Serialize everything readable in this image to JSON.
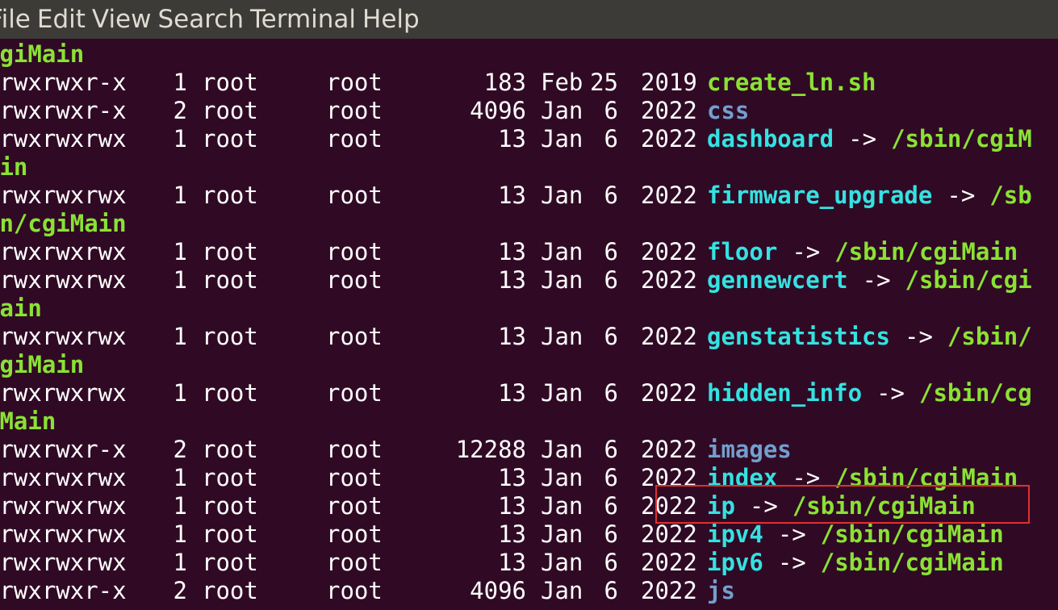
{
  "menubar": {
    "items": [
      "File",
      "Edit",
      "View",
      "Search",
      "Terminal",
      "Help"
    ]
  },
  "colors": {
    "background": "#300a24",
    "menubar_bg": "#3c3b37",
    "text": "#ffffff",
    "executable": "#8ae234",
    "directory": "#729fcf",
    "symlink": "#34e2e2",
    "highlight": "#e03030"
  },
  "listing": [
    {
      "kind": "wrap",
      "text": "cgiMain"
    },
    {
      "kind": "entry",
      "perm": "-rwxrwxr-x",
      "links": "1",
      "owner": "root",
      "group": "root",
      "size": "183",
      "month": "Feb",
      "day": "25",
      "year": "2019",
      "name": "create_ln.sh",
      "type": "exec",
      "arrow": "",
      "target": ""
    },
    {
      "kind": "entry",
      "perm": "drwxrwxr-x",
      "links": "2",
      "owner": "root",
      "group": "root",
      "size": "4096",
      "month": "Jan",
      "day": "6",
      "year": "2022",
      "name": "css",
      "type": "dir",
      "arrow": "",
      "target": ""
    },
    {
      "kind": "entry",
      "perm": "lrwxrwxrwx",
      "links": "1",
      "owner": "root",
      "group": "root",
      "size": "13",
      "month": "Jan",
      "day": "6",
      "year": "2022",
      "name": "dashboard",
      "type": "link",
      "arrow": "->",
      "target": "/sbin/cgiM"
    },
    {
      "kind": "wrap",
      "text": "ain"
    },
    {
      "kind": "entry",
      "perm": "lrwxrwxrwx",
      "links": "1",
      "owner": "root",
      "group": "root",
      "size": "13",
      "month": "Jan",
      "day": "6",
      "year": "2022",
      "name": "firmware_upgrade",
      "type": "link",
      "arrow": "->",
      "target": "/sb"
    },
    {
      "kind": "wrap",
      "text": "in/cgiMain"
    },
    {
      "kind": "entry",
      "perm": "lrwxrwxrwx",
      "links": "1",
      "owner": "root",
      "group": "root",
      "size": "13",
      "month": "Jan",
      "day": "6",
      "year": "2022",
      "name": "floor",
      "type": "link",
      "arrow": "->",
      "target": "/sbin/cgiMain"
    },
    {
      "kind": "entry",
      "perm": "lrwxrwxrwx",
      "links": "1",
      "owner": "root",
      "group": "root",
      "size": "13",
      "month": "Jan",
      "day": "6",
      "year": "2022",
      "name": "gennewcert",
      "type": "link",
      "arrow": "->",
      "target": "/sbin/cgi"
    },
    {
      "kind": "wrap",
      "text": "Main"
    },
    {
      "kind": "entry",
      "perm": "lrwxrwxrwx",
      "links": "1",
      "owner": "root",
      "group": "root",
      "size": "13",
      "month": "Jan",
      "day": "6",
      "year": "2022",
      "name": "genstatistics",
      "type": "link",
      "arrow": "->",
      "target": "/sbin/"
    },
    {
      "kind": "wrap",
      "text": "cgiMain"
    },
    {
      "kind": "entry",
      "perm": "lrwxrwxrwx",
      "links": "1",
      "owner": "root",
      "group": "root",
      "size": "13",
      "month": "Jan",
      "day": "6",
      "year": "2022",
      "name": "hidden_info",
      "type": "link",
      "arrow": "->",
      "target": "/sbin/cg"
    },
    {
      "kind": "wrap",
      "text": "iMain"
    },
    {
      "kind": "entry",
      "perm": "drwxrwxr-x",
      "links": "2",
      "owner": "root",
      "group": "root",
      "size": "12288",
      "month": "Jan",
      "day": "6",
      "year": "2022",
      "name": "images",
      "type": "dir",
      "arrow": "",
      "target": ""
    },
    {
      "kind": "entry",
      "perm": "lrwxrwxrwx",
      "links": "1",
      "owner": "root",
      "group": "root",
      "size": "13",
      "month": "Jan",
      "day": "6",
      "year": "2022",
      "name": "index",
      "type": "link",
      "arrow": "->",
      "target": "/sbin/cgiMain"
    },
    {
      "kind": "entry",
      "perm": "lrwxrwxrwx",
      "links": "1",
      "owner": "root",
      "group": "root",
      "size": "13",
      "month": "Jan",
      "day": "6",
      "year": "2022",
      "name": "ip",
      "type": "link",
      "arrow": "->",
      "target": "/sbin/cgiMain"
    },
    {
      "kind": "entry",
      "perm": "lrwxrwxrwx",
      "links": "1",
      "owner": "root",
      "group": "root",
      "size": "13",
      "month": "Jan",
      "day": "6",
      "year": "2022",
      "name": "ipv4",
      "type": "link",
      "arrow": "->",
      "target": "/sbin/cgiMain"
    },
    {
      "kind": "entry",
      "perm": "lrwxrwxrwx",
      "links": "1",
      "owner": "root",
      "group": "root",
      "size": "13",
      "month": "Jan",
      "day": "6",
      "year": "2022",
      "name": "ipv6",
      "type": "link",
      "arrow": "->",
      "target": "/sbin/cgiMain"
    },
    {
      "kind": "entry",
      "perm": "drwxrwxr-x",
      "links": "2",
      "owner": "root",
      "group": "root",
      "size": "4096",
      "month": "Jan",
      "day": "6",
      "year": "2022",
      "name": "js",
      "type": "dir",
      "arrow": "",
      "target": ""
    }
  ]
}
